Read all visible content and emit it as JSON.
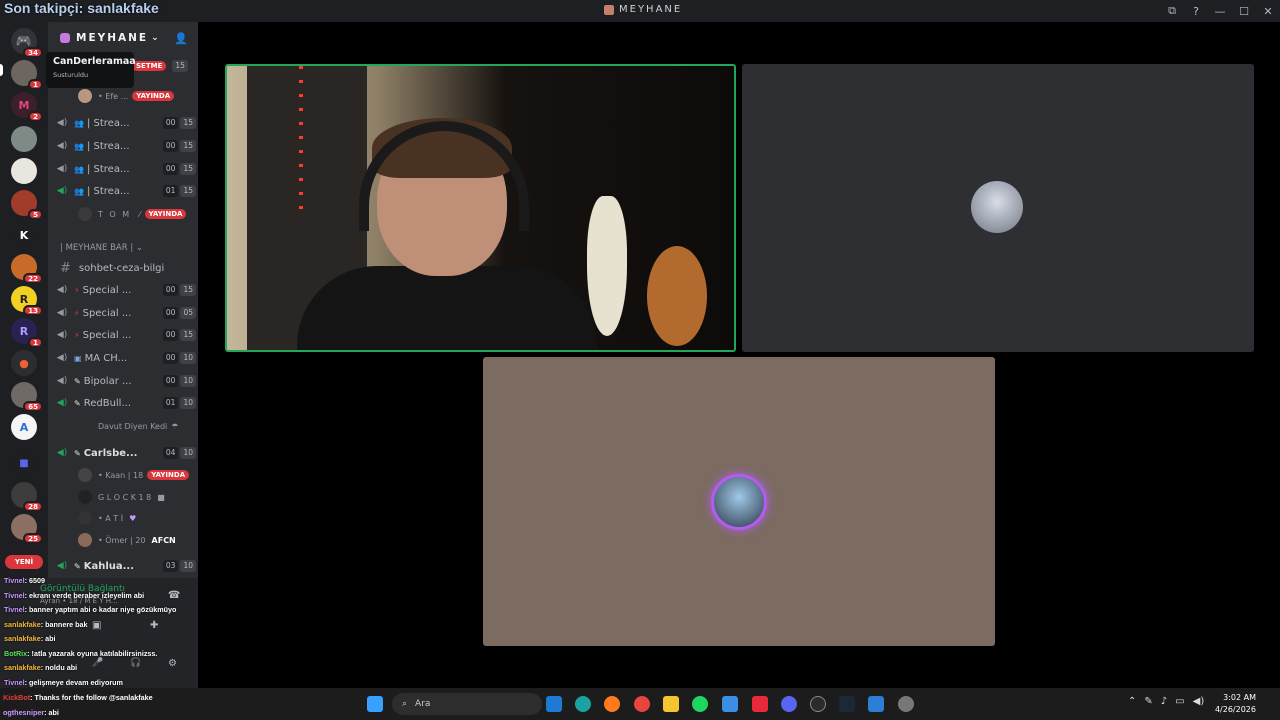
{
  "overlay": {
    "follower_text": "Son takipçi: sanlakfake"
  },
  "window": {
    "title": "MEYHANE",
    "controls": [
      "⧉",
      "?",
      "—",
      "☐",
      "✕"
    ]
  },
  "servers": {
    "badges": [
      "34",
      "1",
      "2",
      "5",
      "22",
      "13",
      "1",
      "65",
      "28",
      "25"
    ],
    "letter_k": "K",
    "new_label": "YENİ"
  },
  "tooltip": {
    "name": "CanDerleramaa",
    "status": "Susturuldu"
  },
  "guild": {
    "name": "MEYHANE",
    "chevron": "⌄"
  },
  "channels": {
    "top_live_partial": "SETME",
    "top_user": "• Efe ...",
    "live_label": "YAYINDA",
    "stream_channels": [
      {
        "name": "| Strea...",
        "count": "00",
        "limit": "15"
      },
      {
        "name": "| Strea...",
        "count": "00",
        "limit": "15"
      },
      {
        "name": "| Strea...",
        "count": "00",
        "limit": "15"
      },
      {
        "name": "| Strea...",
        "count": "01",
        "limit": "15"
      }
    ],
    "tom_user": "T O M",
    "category": "| MEYHANE BAR |",
    "text_channel": "sohbet-ceza-bilgi",
    "special_channels": [
      {
        "name": "Special ...",
        "count": "00",
        "limit": "15"
      },
      {
        "name": "Special ...",
        "count": "00",
        "limit": "05"
      },
      {
        "name": "Special ...",
        "count": "00",
        "limit": "15"
      },
      {
        "name": "MA CH...",
        "count": "00",
        "limit": "10"
      },
      {
        "name": "Bipolar ...",
        "count": "00",
        "limit": "10"
      },
      {
        "name": "RedBull...",
        "count": "01",
        "limit": "10"
      }
    ],
    "davut_user": "Davut Diyen Kedi",
    "carlsberg": {
      "name": "Carlsbe...",
      "count": "04",
      "limit": "10"
    },
    "carlsberg_users": [
      "• Kaan | 18",
      "G L O C K 1 8",
      "• A T İ",
      "• Ömer | 20"
    ],
    "afcn_tag": "AFCN",
    "kahlua": {
      "name": "Kahlua...",
      "count": "03",
      "limit": "10"
    }
  },
  "chat_overlay": [
    {
      "user": "Tivnel",
      "text": ": 6509"
    },
    {
      "user": "Tivnel",
      "text": ": ekranı verde beraber izleyelim abi"
    },
    {
      "user": "Tivnel",
      "text": ": banner yaptım abi o kadar niye gözükmüyo"
    },
    {
      "user": "sanlakfake",
      "text": ": bannere bak"
    },
    {
      "user": "sanlakfake",
      "text": ": abi"
    },
    {
      "user": "BotRix",
      "text": ": !atla yazarak oyuna katılabilirsinizss."
    },
    {
      "user": "sanlakfake",
      "text": ": noldu abi"
    },
    {
      "user": "Tivnel",
      "text": ": gelişmeye devam ediyorum"
    },
    {
      "user": "KickBot",
      "text": ": Thanks for the follow @sanlakfake"
    },
    {
      "user": "ogthesniper",
      "text": ": abi"
    }
  ],
  "voice_panel": {
    "connection": "Görüntülü Bağlantı",
    "channel": "Ayran • 18 / M E Y H..."
  },
  "taskbar": {
    "search_label": "Ara",
    "time": "3:02 AM",
    "date": "4/26/2026"
  },
  "colors": {
    "speaking_border": "#23a55a",
    "live_red": "#da373c",
    "avatar_ring": "#b45cf0"
  }
}
